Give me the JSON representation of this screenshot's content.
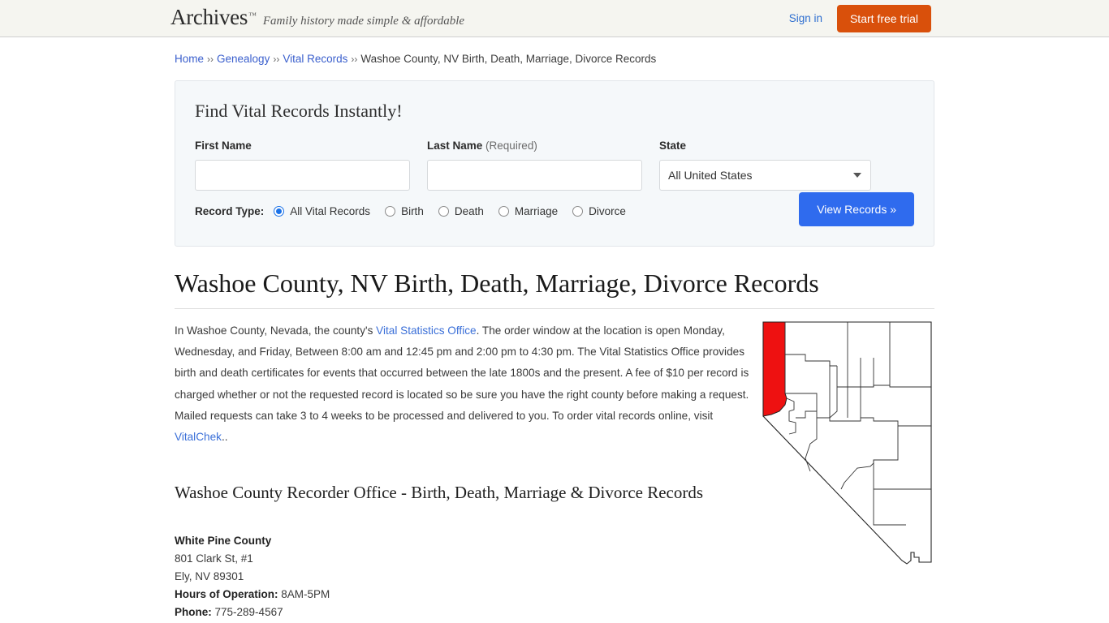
{
  "header": {
    "logo_text": "Archives",
    "logo_tm": "™",
    "tagline": "Family history made simple & affordable",
    "sign_in_label": "Sign in",
    "trial_label": "Start free trial",
    "trial_color": "#d9500b",
    "link_color": "#2f6fd0"
  },
  "breadcrumb": {
    "separator": "››",
    "items": [
      {
        "label": "Home",
        "link": true
      },
      {
        "label": "Genealogy",
        "link": true
      },
      {
        "label": "Vital Records",
        "link": true
      },
      {
        "label": "Washoe County, NV Birth, Death, Marriage, Divorce Records",
        "link": false
      }
    ]
  },
  "search_panel": {
    "title": "Find Vital Records Instantly!",
    "first_name": {
      "label": "First Name",
      "value": "",
      "placeholder": ""
    },
    "last_name": {
      "label": "Last Name",
      "required_note": "(Required)",
      "value": "",
      "placeholder": ""
    },
    "state": {
      "label": "State",
      "selected": "All United States",
      "options": [
        "All United States"
      ]
    },
    "record_type": {
      "label": "Record Type:",
      "selected": "All Vital Records",
      "options": [
        "All Vital Records",
        "Birth",
        "Death",
        "Marriage",
        "Divorce"
      ]
    },
    "submit_label": "View Records »",
    "submit_color": "#2f6bee"
  },
  "main": {
    "page_title": "Washoe County, NV Birth, Death, Marriage, Divorce Records",
    "paragraph": {
      "part1": "In Washoe County, Nevada, the county's ",
      "link1": "Vital Statistics Office",
      "part2": ". The order window at the location is open Monday, Wednesday, and Friday, Between 8:00 am and 12:45 pm and 2:00 pm to 4:30 pm. The Vital Statistics Office provides birth and death certificates for events that occurred between the late 1800s and the present. A fee of $10 per record is charged whether or not the requested record is located so be sure you have the right county before making a request. Mailed requests can take 3 to 4 weeks to be processed and delivered to you. To order vital records online, visit ",
      "link2": "VitalChek",
      "part3": ".."
    },
    "sub_heading": "Washoe County Recorder Office - Birth, Death, Marriage & Divorce Records",
    "address": {
      "name": "White Pine County",
      "street": "801 Clark St, #1",
      "city_state_zip": "Ely, NV 89301",
      "hours_label": "Hours of Operation:",
      "hours_value": "8AM-5PM",
      "phone_label": "Phone:",
      "phone_value": "775-289-4567"
    },
    "map": {
      "name": "nevada-county-map",
      "state": "Nevada",
      "highlighted_county": "Washoe County",
      "highlight_color": "#ee1111",
      "fill_color": "#ffffff",
      "stroke_color": "#222222"
    }
  }
}
